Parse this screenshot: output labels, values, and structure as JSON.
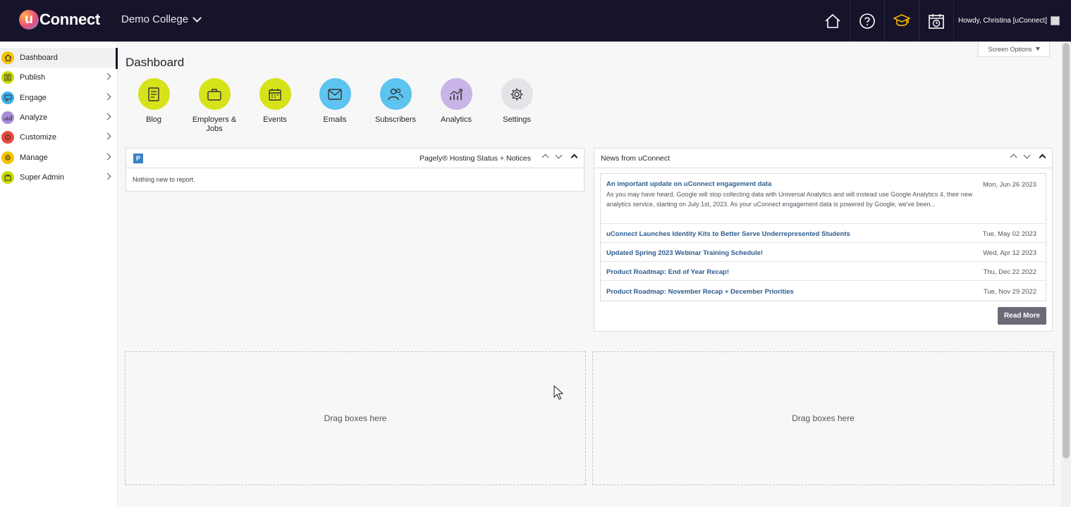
{
  "topbar": {
    "logo_letter": "u",
    "logo_text": "Connect",
    "college": "Demo College",
    "icons": [
      "home-icon",
      "help-icon",
      "graduation-cap-icon",
      "calendar-clock-icon"
    ],
    "howdy": "Howdy, Christina [uConnect]"
  },
  "sidebar": {
    "items": [
      {
        "label": "Dashboard",
        "icon": "home-icon",
        "color": "#f4c300"
      },
      {
        "label": "Publish",
        "icon": "publish-icon",
        "color": "#c7d900"
      },
      {
        "label": "Engage",
        "icon": "engage-icon",
        "color": "#3bb0e6"
      },
      {
        "label": "Analyze",
        "icon": "analyze-icon",
        "color": "#a98bd9"
      },
      {
        "label": "Customize",
        "icon": "customize-icon",
        "color": "#e54a3c"
      },
      {
        "label": "Manage",
        "icon": "manage-icon",
        "color": "#f4c300"
      },
      {
        "label": "Super Admin",
        "icon": "super-admin-icon",
        "color": "#c7d900"
      }
    ]
  },
  "main": {
    "title": "Dashboard",
    "screen_options": "Screen Options",
    "quick_links": [
      {
        "label": "Blog",
        "color": "#d6e21a"
      },
      {
        "label": "Employers & Jobs",
        "color": "#d6e21a"
      },
      {
        "label": "Events",
        "color": "#d6e21a"
      },
      {
        "label": "Emails",
        "color": "#5dc4ef"
      },
      {
        "label": "Subscribers",
        "color": "#5dc4ef"
      },
      {
        "label": "Analytics",
        "color": "#c8b4e6"
      },
      {
        "label": "Settings",
        "color": "#e4e4e8"
      }
    ],
    "pagely": {
      "badge": "P",
      "title": "Pagely® Hosting Status + Notices",
      "body": "Nothing new to report."
    },
    "news": {
      "title": "News from uConnect",
      "items": [
        {
          "title": "An important update on uConnect engagement data",
          "date": "Mon, Jun 26 2023",
          "excerpt": "As you may have heard, Google will stop collecting data with Universal Analytics and will instead use Google Analytics 4, their new analytics service, starting on July 1st, 2023. As your uConnect engagement data is powered by Google, we've been..."
        },
        {
          "title": "uConnect Launches Identity Kits to Better Serve Underrepresented Students",
          "date": "Tue, May 02 2023"
        },
        {
          "title": "Updated Spring 2023 Webinar Training Schedule!",
          "date": "Wed, Apr 12 2023"
        },
        {
          "title": "Product Roadmap: End of Year Recap!",
          "date": "Thu, Dec 22 2022"
        },
        {
          "title": "Product Roadmap: November Recap + December Priorities",
          "date": "Tue, Nov 29 2022"
        }
      ],
      "read_more": "Read More"
    },
    "dropzone_left": "Drag boxes here",
    "dropzone_right": "Drag boxes here"
  }
}
